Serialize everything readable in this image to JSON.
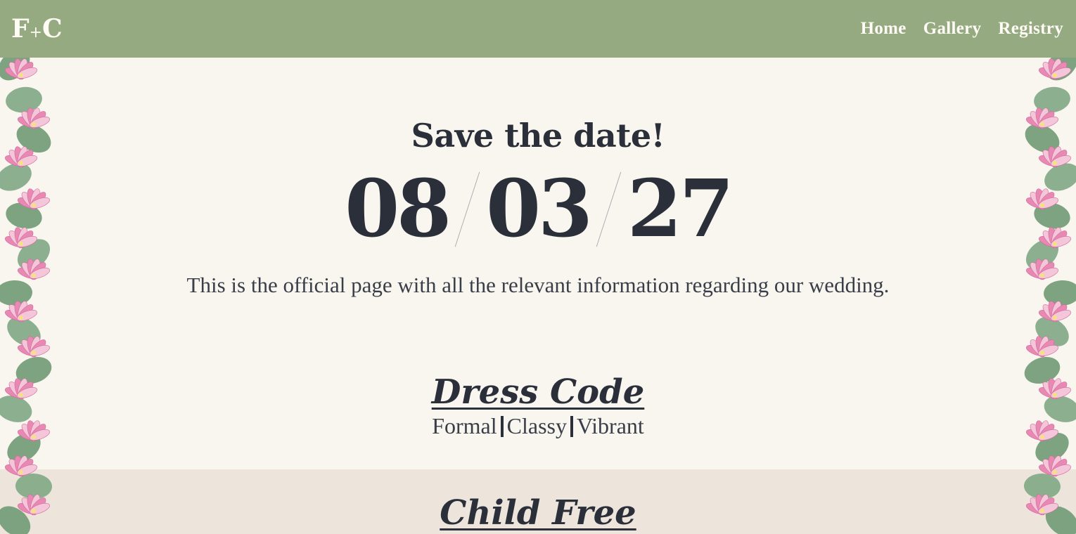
{
  "nav": {
    "logo_left": "F",
    "logo_plus": "+",
    "logo_right": "C",
    "links": [
      {
        "label": "Home"
      },
      {
        "label": "Gallery"
      },
      {
        "label": "Registry"
      }
    ]
  },
  "hero": {
    "title": "Save the date!",
    "date": {
      "month": "08",
      "day": "03",
      "year": "27"
    },
    "subtitle": "This is the official page with all the relevant information regarding our wedding."
  },
  "dress_code": {
    "title": "Dress Code",
    "items": [
      "Formal",
      "Classy",
      "Vibrant"
    ]
  },
  "child_free": {
    "title": "Child Free"
  },
  "colors": {
    "nav_bg": "#96aa82",
    "page_bg": "#f8f6ee",
    "band_bg": "#ede5db",
    "text": "#2b2f3a",
    "flower_pink": "#e889b4",
    "leaf_green": "#6f9a74"
  },
  "decor": {
    "left_border": "lotus-floral-border",
    "right_border": "lotus-floral-border"
  }
}
